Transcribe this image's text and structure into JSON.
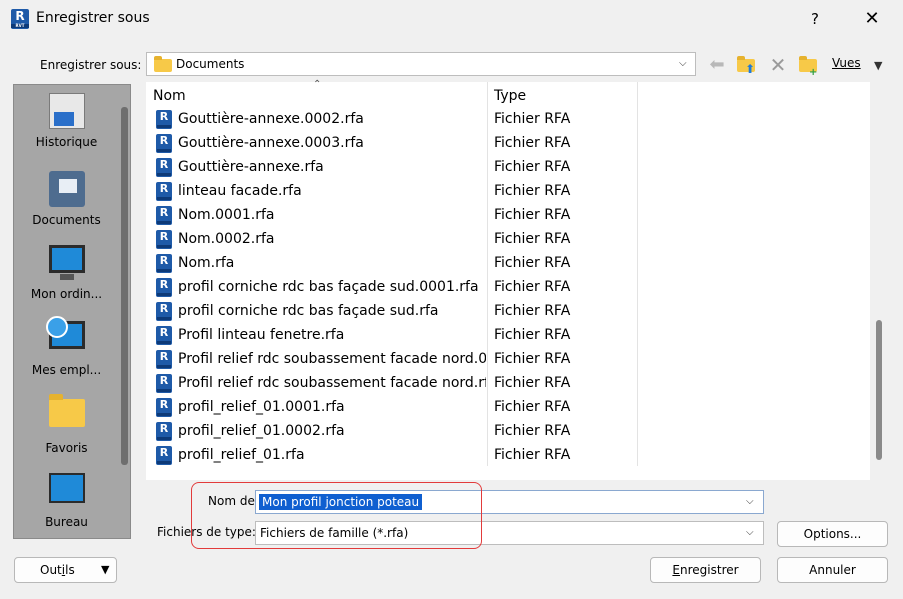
{
  "window": {
    "title": "Enregistrer sous",
    "app_icon": "R",
    "app_icon_sub": "RVT",
    "help": "?",
    "close": "✕"
  },
  "location": {
    "label": "Enregistrer sous:",
    "value": "Documents"
  },
  "toolbar": {
    "back_icon": "arrow-left-icon",
    "up_folder_icon": "folder-up-icon",
    "delete_icon": "delete-icon",
    "new_folder_icon": "new-folder-icon",
    "views_label_prefix": "",
    "views_label": "Vues"
  },
  "sidebar": {
    "items": [
      {
        "label": "Historique",
        "icon": "history-icon"
      },
      {
        "label": "Documents",
        "icon": "documents-icon"
      },
      {
        "label": "Mon ordin...",
        "icon": "computer-icon"
      },
      {
        "label": "Mes empl...",
        "icon": "network-places-icon"
      },
      {
        "label": "Favoris",
        "icon": "favorites-folder-icon"
      },
      {
        "label": "Bureau",
        "icon": "desktop-icon"
      }
    ]
  },
  "filelist": {
    "columns": [
      "Nom",
      "Type"
    ],
    "rows": [
      {
        "name": "Gouttière-annexe.0002.rfa",
        "type": "Fichier RFA"
      },
      {
        "name": "Gouttière-annexe.0003.rfa",
        "type": "Fichier RFA"
      },
      {
        "name": "Gouttière-annexe.rfa",
        "type": "Fichier RFA"
      },
      {
        "name": "linteau facade.rfa",
        "type": "Fichier RFA"
      },
      {
        "name": "Nom.0001.rfa",
        "type": "Fichier RFA"
      },
      {
        "name": "Nom.0002.rfa",
        "type": "Fichier RFA"
      },
      {
        "name": "Nom.rfa",
        "type": "Fichier RFA"
      },
      {
        "name": "profil corniche rdc bas façade sud.0001.rfa",
        "type": "Fichier RFA"
      },
      {
        "name": "profil corniche rdc bas façade sud.rfa",
        "type": "Fichier RFA"
      },
      {
        "name": "Profil linteau fenetre.rfa",
        "type": "Fichier RFA"
      },
      {
        "name": "Profil relief rdc soubassement facade nord.0...",
        "type": "Fichier RFA"
      },
      {
        "name": "Profil relief rdc soubassement facade nord.rfa",
        "type": "Fichier RFA"
      },
      {
        "name": "profil_relief_01.0001.rfa",
        "type": "Fichier RFA"
      },
      {
        "name": "profil_relief_01.0002.rfa",
        "type": "Fichier RFA"
      },
      {
        "name": "profil_relief_01.rfa",
        "type": "Fichier RFA"
      }
    ]
  },
  "form": {
    "name_label": "Nom de",
    "name_value": "Mon profil jonction poteau",
    "type_label": "Fichiers de type:",
    "type_value": "Fichiers de famille  (*.rfa)"
  },
  "buttons": {
    "options": "Options...",
    "tools_prefix": "Out",
    "tools_underline": "i",
    "tools_suffix": "ls",
    "save_underline": "E",
    "save_rest": "nregistrer",
    "cancel": "Annuler"
  },
  "colors": {
    "accent": "#1e5aa8",
    "selection": "#0f5fd0",
    "highlight_ring": "#e23b3b"
  }
}
